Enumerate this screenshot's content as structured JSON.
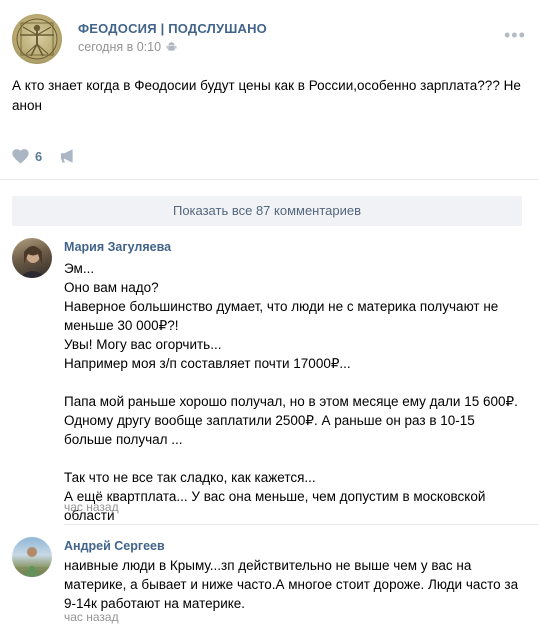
{
  "post": {
    "group_name": "ФЕОДОСИЯ | ПОДСЛУШАНО",
    "time": "сегодня в 0:10",
    "text": "А кто знает когда в Феодосии будут цены как в России,особенно зарплата??? Не анон",
    "likes": "6",
    "more_icon": "more-horizontal-icon",
    "device_icon": "android-icon"
  },
  "comments_bar": {
    "show_all_label": "Показать все 87 комментариев"
  },
  "comments": [
    {
      "author": "Мария Загуляева",
      "lines": [
        "Эм...",
        "Оно вам надо?",
        "Наверное большинство думает, что люди не с материка получают не меньше 30 000₽?!",
        "Увы! Могу вас огорчить...",
        "Например моя з/п составляет почти 17000₽...",
        "",
        "Папа мой раньше хорошо получал, но в этом месяце ему дали 15 600₽. Одному другу вообще заплатили 2500₽. А раньше он раз в 10-15 больше получал ...",
        "",
        "Так что не все так сладко, как кажется...",
        "А ещё квартплата... У вас она меньше, чем допустим в московской области"
      ],
      "time": "час назад"
    },
    {
      "author": "Андрей Сергеев",
      "lines": [
        "наивные люди в Крыму...зп действительно не выше чем у вас на материке, а бывает и ниже часто.А многое стоит дороже. Люди часто за 9-14к работают на материке."
      ],
      "time": "час назад"
    }
  ],
  "colors": {
    "link_blue": "#42648b",
    "meta_gray": "#939393",
    "show_all_bg": "#f0f2f5",
    "like_gray": "#5d7a99"
  }
}
